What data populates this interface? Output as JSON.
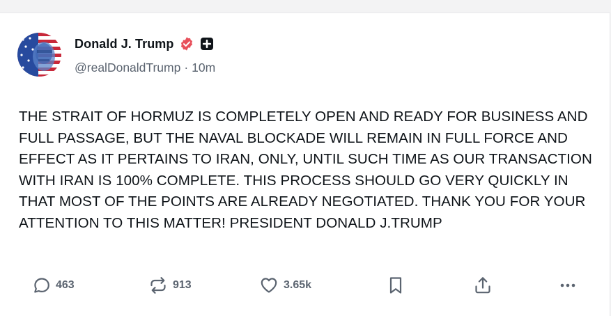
{
  "post": {
    "author": {
      "display_name": "Donald J. Trump",
      "handle": "@realDonaldTrump",
      "separator": "·",
      "time_ago": "10m",
      "verified_icon": "verified-badge-icon",
      "verified_color": "#e8505b",
      "plus_icon": "plus-badge-icon"
    },
    "text": "THE STRAIT OF HORMUZ IS COMPLETELY OPEN AND READY FOR BUSINESS AND FULL PASSAGE, BUT THE NAVAL BLOCKADE WILL REMAIN IN FULL FORCE AND EFFECT AS IT PERTAINS TO IRAN, ONLY, UNTIL SUCH TIME AS OUR TRANSACTION WITH IRAN IS 100% COMPLETE. THIS PROCESS SHOULD GO VERY QUICKLY IN THAT MOST OF THE POINTS ARE ALREADY NEGOTIATED. THANK YOU FOR YOUR ATTENTION TO THIS MATTER! PRESIDENT DONALD J.TRUMP",
    "actions": {
      "replies": "463",
      "retruths": "913",
      "likes": "3.65k",
      "icons": [
        "reply-icon",
        "retruth-icon",
        "like-icon",
        "bookmark-icon",
        "share-icon",
        "more-icon"
      ]
    }
  },
  "colors": {
    "text": "#0f1419",
    "muted": "#5b6470",
    "background": "#ffffff",
    "page_background": "#f3f3f4"
  }
}
